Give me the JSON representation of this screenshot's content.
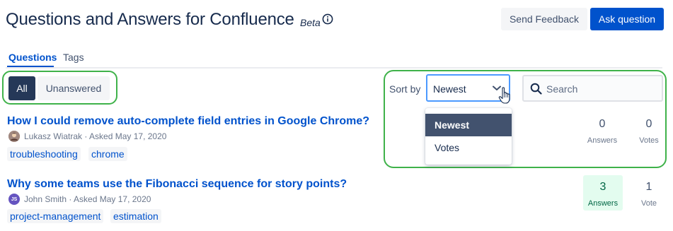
{
  "header": {
    "title": "Questions and Answers for Confluence",
    "beta": "Beta",
    "feedback_label": "Send Feedback",
    "ask_label": "Ask question"
  },
  "tabs": [
    {
      "label": "Questions",
      "active": true
    },
    {
      "label": "Tags",
      "active": false
    }
  ],
  "filters": {
    "all_label": "All",
    "unanswered_label": "Unanswered",
    "selected": "All"
  },
  "sort": {
    "label": "Sort by",
    "value": "Newest",
    "options": [
      "Newest",
      "Votes"
    ]
  },
  "search": {
    "placeholder": "Search"
  },
  "questions": [
    {
      "title": "How I could remove auto-complete field entries in Google Chrome?",
      "author": "Lukasz Wiatrak",
      "asked": "· Asked May 17, 2020",
      "tags": [
        "troubleshooting",
        "chrome"
      ],
      "answers": "0",
      "answers_label": "Answers",
      "votes": "0",
      "votes_label": "Votes"
    },
    {
      "title": "Why some teams use the Fibonacci sequence for story points?",
      "author": "John Smith",
      "author_initials": "JS",
      "asked": "· Asked May 17, 2020",
      "tags": [
        "project-management",
        "estimation"
      ],
      "answers": "3",
      "answers_label": "Answers",
      "votes": "1",
      "votes_label": "Vote"
    }
  ],
  "colors": {
    "primary": "#0052cc",
    "selected_filter": "#253858",
    "annotation_green": "#3fb24a",
    "answered_bg": "#e3fcef"
  },
  "icons": {
    "info": "info-icon",
    "search": "search-icon",
    "chevron": "chevron-down-icon",
    "cursor": "hand-cursor-icon"
  }
}
